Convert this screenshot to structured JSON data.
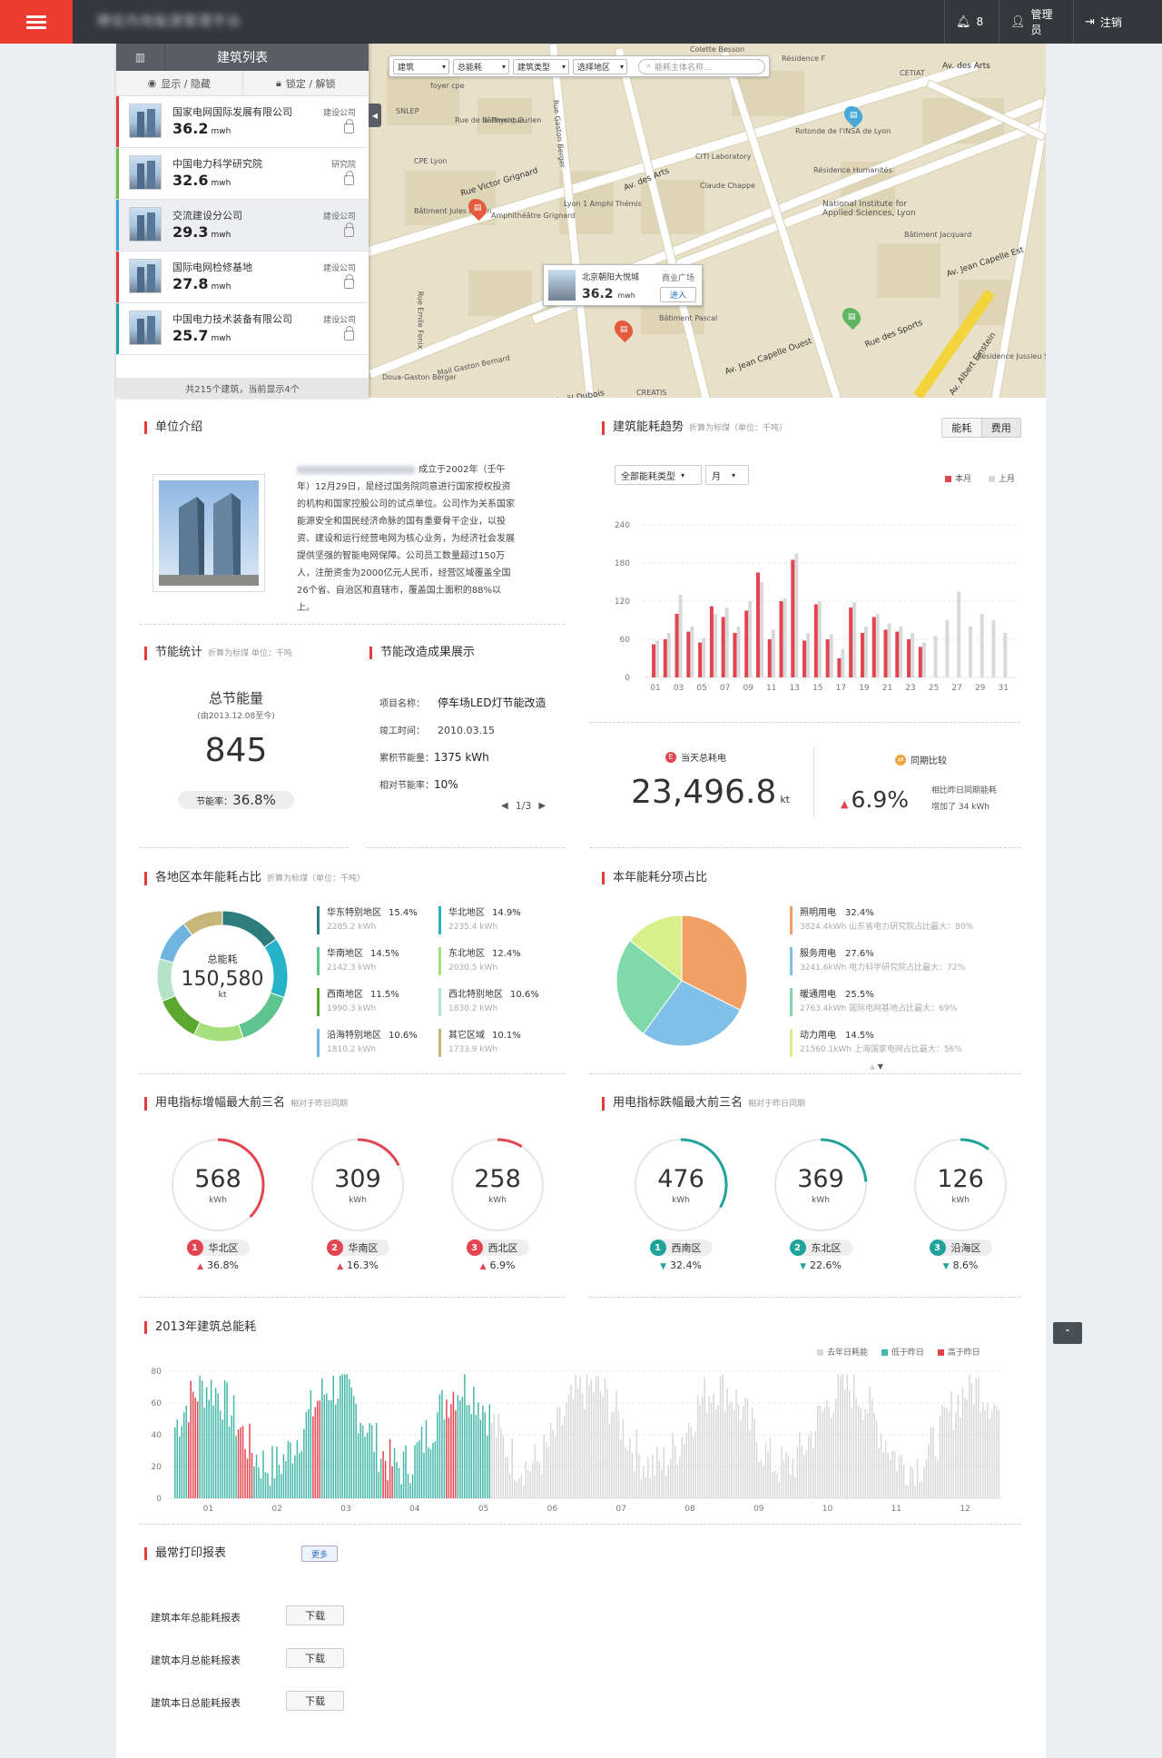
{
  "header": {
    "app_title": "博信内地能源管理平台",
    "notifications": "8",
    "user": "管理员",
    "logout": "注销"
  },
  "sidebar": {
    "title": "建筑列表",
    "show_hide": "显示 / 隐藏",
    "lock_unlock": "锁定 / 解锁",
    "items": [
      {
        "name": "国家电网国际发展有限公司",
        "type": "建设公司",
        "value": "36.2",
        "unit": "mwh",
        "color": "#e33b3b"
      },
      {
        "name": "中国电力科学研究院",
        "type": "研究院",
        "value": "32.6",
        "unit": "mwh",
        "color": "#6cbf45"
      },
      {
        "name": "交流建设分公司",
        "type": "建设公司",
        "value": "29.3",
        "unit": "mwh",
        "color": "#3da2e0"
      },
      {
        "name": "国际电网检修基地",
        "type": "建设公司",
        "value": "27.8",
        "unit": "mwh",
        "color": "#e33b3b"
      },
      {
        "name": "中国电力技术装备有限公司",
        "type": "建设公司",
        "value": "25.7",
        "unit": "mwh",
        "color": "#1fa39a"
      }
    ],
    "footer": "共215个建筑，当前显示4个"
  },
  "map": {
    "filters": [
      "建筑",
      "总能耗",
      "建筑类型",
      "选择地区"
    ],
    "search_placeholder": "能耗主体名称...",
    "labels": [
      "Colette Besson",
      "Résidence F",
      "CETIAT",
      "Av. des Arts",
      "foyer cpe",
      "SNLEP",
      "Rue de la Physique",
      "CPE Lyon",
      "Rue Victor Grignard",
      "Bâtiment Jules Raulin",
      "Amphithéâtre Grignard",
      "Bâtiment Curien",
      "Lyon 1 Amphi Thémis",
      "Av. des Arts",
      "CITI Laboratory",
      "Claude Chappe",
      "Rotonde de l'INSA de Lyon",
      "Résidence Humanités",
      "National Institute for Applied Sciences, Lyon",
      "Bâtiment Jacquard",
      "Av. Jean Capelle Est",
      "Rue des Sports",
      "Av. Albert Einstein",
      "Rue Raphaël Dubois",
      "Rue Emile Fenix",
      "Mail Gaston Bernard",
      "Doua-Gaston Berger",
      "CREATIS",
      "Bâtiment Pascal",
      "Rue Gaston Berger",
      "Av. Jean Capelle Ouest",
      "Résidence Jussieu Studios"
    ],
    "popup": {
      "name": "北京朝阳大悦城",
      "type": "商业广场",
      "value": "36.2",
      "unit": "mwh",
      "enter": "进入"
    }
  },
  "intro": {
    "title": "单位介绍",
    "text": "成立于2002年（壬午年）12月29日，是经过国务院同意进行国家授权投资的机构和国家控股公司的试点单位。公司作为关系国家能源安全和国民经济命脉的国有重要骨干企业，以投资、建设和运行经营电网为核心业务，为经济社会发展提供坚强的智能电网保障。公司员工数量超过150万人，注册资金为2000亿元人民币，经营区域覆盖全国26个省、自治区和直辖市，覆盖国土面积的88%以上。"
  },
  "trend": {
    "title": "建筑能耗趋势",
    "subtitle": "折算为标煤（单位：千吨）",
    "tab_energy": "能耗",
    "tab_cost": "费用",
    "type_select": "全部能耗类型",
    "period_select": "月",
    "legend_current": "本月",
    "legend_prev": "上月"
  },
  "saving": {
    "title": "节能统计",
    "subtitle": "折算为标煤 单位：千吨",
    "total_label": "总节能量",
    "since": "(由2013.12.08至今)",
    "total": "845",
    "rate_label": "节能率：",
    "rate": "36.8%"
  },
  "retrofit": {
    "title": "节能改造成果展示",
    "project_label": "项目名称：",
    "project": "停车场LED灯节能改造",
    "date_label": "竣工时间：",
    "date": "2010.03.15",
    "cumulative_label": "累积节能量：",
    "cumulative": "1375 kWh",
    "relative_label": "相对节能率：",
    "relative": "10%",
    "pager": "1/3"
  },
  "today": {
    "label": "当天总耗电",
    "value": "23,496.8",
    "unit": "kt",
    "compare_label": "同期比较",
    "compare_value": "6.9%",
    "compare_text": "相比昨日同期能耗",
    "compare_delta": "增加了 34 kWh"
  },
  "regions": {
    "title": "各地区本年能耗占比",
    "subtitle": "折算为标煤（单位：千吨）",
    "total_label": "总能耗",
    "total": "150,580",
    "total_unit": "kt",
    "items": [
      {
        "name": "华东特别地区",
        "pct": "15.4%",
        "kwh": "2285.2 kWh",
        "color": "#2e7d7e"
      },
      {
        "name": "华北地区",
        "pct": "14.9%",
        "kwh": "2235.4 kWh",
        "color": "#26b3c7"
      },
      {
        "name": "华南地区",
        "pct": "14.5%",
        "kwh": "2142.3 kWh",
        "color": "#5cc48c"
      },
      {
        "name": "东北地区",
        "pct": "12.4%",
        "kwh": "2030.5 kWh",
        "color": "#a6e07c"
      },
      {
        "name": "西南地区",
        "pct": "11.5%",
        "kwh": "1990.3 kWh",
        "color": "#5aa832"
      },
      {
        "name": "西北特别地区",
        "pct": "10.6%",
        "kwh": "1830.2 kWh",
        "color": "#b6e3c7"
      },
      {
        "name": "沿海特别地区",
        "pct": "10.6%",
        "kwh": "1810.2 kWh",
        "color": "#6fb5e0"
      },
      {
        "name": "其它区域",
        "pct": "10.1%",
        "kwh": "1733.9 kWh",
        "color": "#c8b57a"
      }
    ]
  },
  "categories": {
    "title": "本年能耗分项占比",
    "items": [
      {
        "name": "照明用电",
        "pct": "32.4%",
        "detail": "3824.4kWh  山东省电力研究院占比最大：80%",
        "color": "#f0a065"
      },
      {
        "name": "服务用电",
        "pct": "27.6%",
        "detail": "3241.6kWh  电力科学研究院占比最大：72%",
        "color": "#7fbfe8"
      },
      {
        "name": "暖通用电",
        "pct": "25.5%",
        "detail": "2763.4kWh  国际电网基地占比最大：69%",
        "color": "#80d9a8"
      },
      {
        "name": "动力用电",
        "pct": "14.5%",
        "detail": "21560.1kWh  上海国家电网占比最大：56%",
        "color": "#d7f08a"
      }
    ]
  },
  "top_increase": {
    "title": "用电指标增幅最大前三名",
    "subtitle": "相对于昨日同期",
    "items": [
      {
        "rank": "1",
        "value": "568",
        "unit": "kWh",
        "region": "华北区",
        "pct": "36.8%",
        "frac": 0.368
      },
      {
        "rank": "2",
        "value": "309",
        "unit": "kWh",
        "region": "华南区",
        "pct": "16.3%",
        "frac": 0.163
      },
      {
        "rank": "3",
        "value": "258",
        "unit": "kWh",
        "region": "西北区",
        "pct": "6.9%",
        "frac": 0.069
      }
    ]
  },
  "top_decrease": {
    "title": "用电指标跌幅最大前三名",
    "subtitle": "相对于昨日同期",
    "items": [
      {
        "rank": "1",
        "value": "476",
        "unit": "kWh",
        "region": "西南区",
        "pct": "32.4%",
        "frac": 0.324
      },
      {
        "rank": "2",
        "value": "369",
        "unit": "kWh",
        "region": "东北区",
        "pct": "22.6%",
        "frac": 0.226
      },
      {
        "rank": "3",
        "value": "126",
        "unit": "kWh",
        "region": "沿海区",
        "pct": "8.6%",
        "frac": 0.086
      }
    ]
  },
  "annual": {
    "title": "2013年建筑总能耗",
    "legend_last": "去年日耗能",
    "legend_low": "低于昨日",
    "legend_high": "高于昨日"
  },
  "reports": {
    "title": "最常打印报表",
    "more": "更多",
    "items": [
      {
        "name": "建筑本年总能耗报表",
        "action": "下载"
      },
      {
        "name": "建筑本月总能耗报表",
        "action": "下载"
      },
      {
        "name": "建筑本日总能耗报表",
        "action": "下载"
      }
    ]
  },
  "chart_data": [
    {
      "type": "bar",
      "title": "建筑能耗趋势",
      "ylim": [
        0,
        240
      ],
      "yticks": [
        0,
        60,
        120,
        180,
        240
      ],
      "x": [
        "01",
        "02",
        "03",
        "04",
        "05",
        "06",
        "07",
        "08",
        "09",
        "10",
        "11",
        "12",
        "13",
        "14",
        "15",
        "16",
        "17",
        "18",
        "19",
        "20",
        "21",
        "22",
        "23",
        "24",
        "25",
        "26",
        "27",
        "28",
        "29",
        "30",
        "31"
      ],
      "xticks": [
        "01",
        "03",
        "05",
        "07",
        "09",
        "11",
        "13",
        "15",
        "17",
        "19",
        "21",
        "23",
        "25",
        "27",
        "29",
        "31"
      ],
      "series": [
        {
          "name": "本月",
          "color": "#e2454f",
          "values": [
            52,
            60,
            100,
            72,
            55,
            112,
            95,
            70,
            105,
            165,
            60,
            120,
            185,
            58,
            115,
            60,
            30,
            110,
            70,
            95,
            75,
            72,
            60,
            48,
            0,
            0,
            0,
            0,
            0,
            0,
            0
          ]
        },
        {
          "name": "上月",
          "color": "#d9d9d9",
          "values": [
            58,
            70,
            130,
            80,
            62,
            100,
            110,
            80,
            120,
            150,
            75,
            125,
            195,
            70,
            120,
            68,
            45,
            118,
            80,
            100,
            85,
            80,
            70,
            55,
            65,
            90,
            135,
            80,
            100,
            90,
            70
          ]
        }
      ]
    },
    {
      "type": "pie",
      "title": "各地区本年能耗占比",
      "labels": [
        "华东特别地区",
        "华北地区",
        "华南地区",
        "东北地区",
        "西南地区",
        "西北特别地区",
        "沿海特别地区",
        "其它区域"
      ],
      "values": [
        15.4,
        14.9,
        14.5,
        12.4,
        11.5,
        10.6,
        10.6,
        10.1
      ]
    },
    {
      "type": "pie",
      "title": "本年能耗分项占比",
      "labels": [
        "照明用电",
        "服务用电",
        "暖通用电",
        "动力用电"
      ],
      "values": [
        32.4,
        27.6,
        25.5,
        14.5
      ]
    },
    {
      "type": "bar",
      "title": "2013年建筑总能耗",
      "ylim": [
        0,
        80
      ],
      "yticks": [
        0,
        20,
        40,
        60,
        80
      ],
      "xticks": [
        "01",
        "02",
        "03",
        "04",
        "05",
        "06",
        "07",
        "08",
        "09",
        "10",
        "11",
        "12"
      ],
      "days_shown": 365,
      "days_current": 140,
      "red_days": [
        6,
        7,
        8,
        9,
        10,
        28,
        29,
        30,
        31,
        32,
        33,
        34,
        61,
        62,
        63,
        64,
        92,
        93,
        94,
        95,
        96,
        120,
        121,
        122,
        123,
        124
      ]
    }
  ]
}
